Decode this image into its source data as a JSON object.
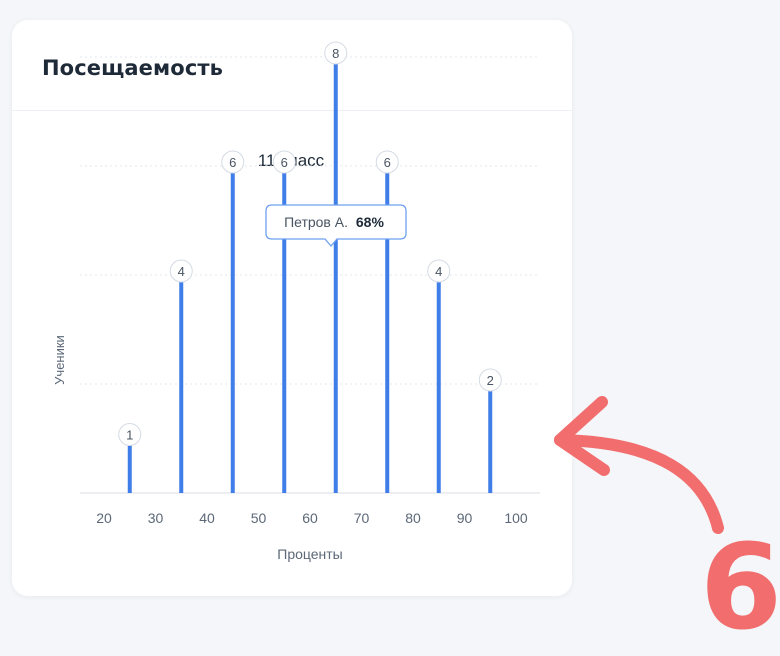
{
  "card": {
    "title": "Посещаемость"
  },
  "chart_data": {
    "type": "bar",
    "title": "11 класс",
    "xlabel": "Проценты",
    "ylabel": "Ученики",
    "x": [
      25,
      35,
      45,
      55,
      65,
      75,
      85,
      95
    ],
    "values": [
      1,
      4,
      6,
      6,
      8,
      6,
      4,
      2
    ],
    "x_ticks": [
      20,
      30,
      40,
      50,
      60,
      70,
      80,
      90,
      100
    ],
    "xlim": [
      20,
      100
    ],
    "ylim": [
      0,
      10
    ],
    "grid": true,
    "bar_color": "#3f7de8",
    "tooltip": {
      "name": "Петров А.",
      "value": "68%"
    }
  },
  "annotation": {
    "label": "6",
    "color": "#f26d6d"
  }
}
